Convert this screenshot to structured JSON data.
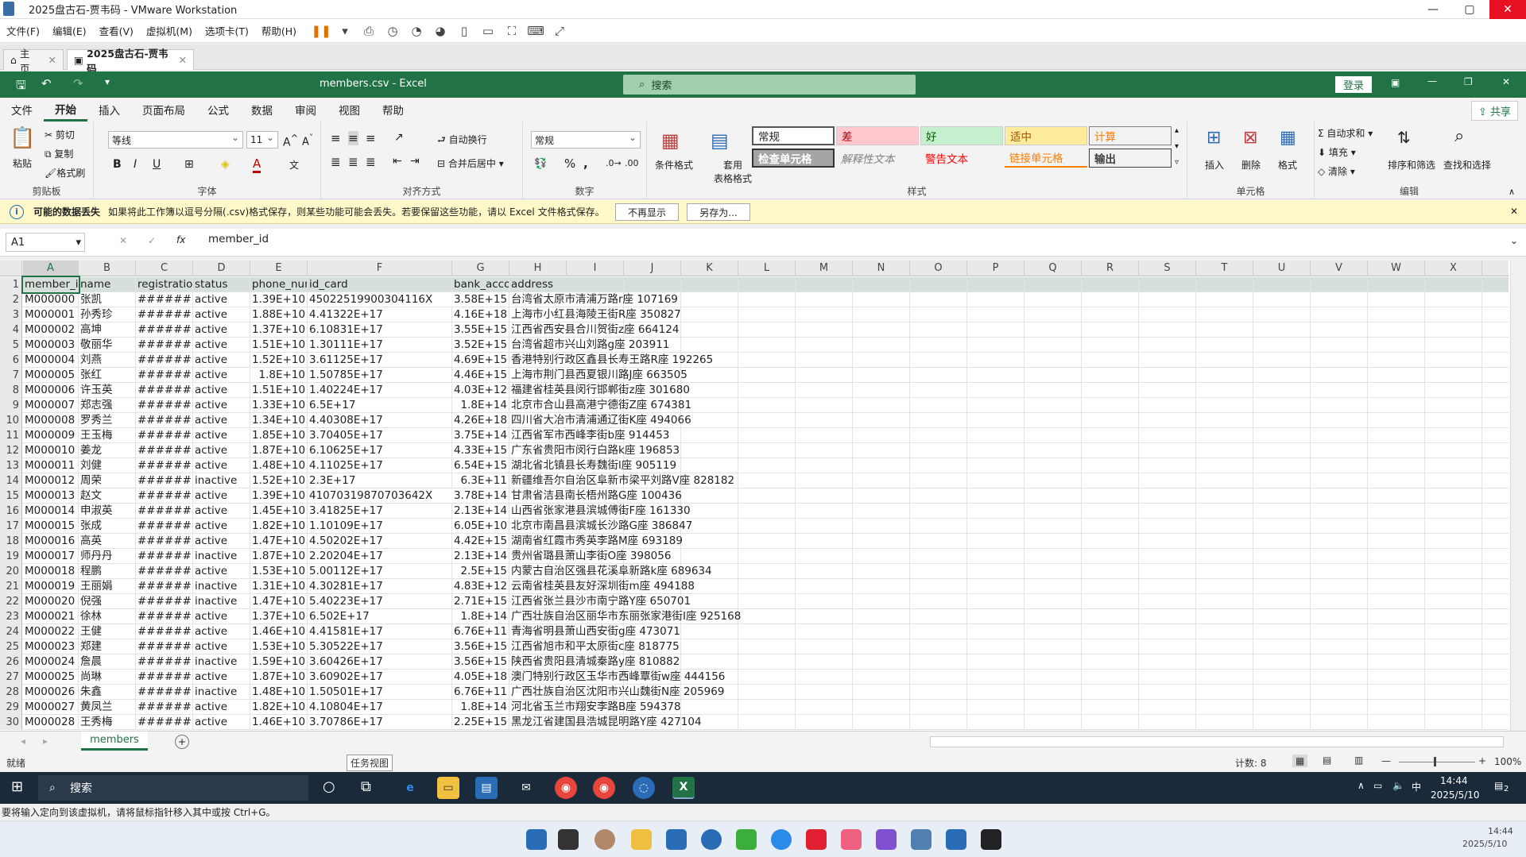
{
  "vmware": {
    "window_title": "2025盘古石-贾韦码 - VMware Workstation",
    "menu": [
      "文件(F)",
      "编辑(E)",
      "查看(V)",
      "虚拟机(M)",
      "选项卡(T)",
      "帮助(H)"
    ],
    "tabs": [
      {
        "label": "主页"
      },
      {
        "label": "2025盘古石-贾韦码"
      }
    ],
    "status_hint": "要将输入定向到该虚拟机，请将鼠标指针移入其中或按 Ctrl+G。"
  },
  "excel": {
    "file_title": "members.csv  -  Excel",
    "search_placeholder": "搜索",
    "login": "登录",
    "share": "共享",
    "ribbon_tabs": [
      "文件",
      "开始",
      "插入",
      "页面布局",
      "公式",
      "数据",
      "审阅",
      "视图",
      "帮助"
    ],
    "clipboard": {
      "paste": "粘贴",
      "cut": "剪切",
      "copy": "复制",
      "format_painter": "格式刷",
      "label": "剪贴板"
    },
    "font": {
      "name": "等线",
      "size": "11",
      "label": "字体"
    },
    "alignment": {
      "wrap": "自动换行",
      "merge": "合并后居中",
      "label": "对齐方式"
    },
    "number": {
      "format": "常规",
      "label": "数字"
    },
    "styles": {
      "conditional": "条件格式",
      "table": "套用\n表格格式",
      "items": [
        "常规",
        "差",
        "好",
        "适中",
        "计算",
        "检查单元格",
        "解释性文本",
        "警告文本",
        "链接单元格",
        "输出"
      ],
      "label": "样式"
    },
    "cells": {
      "insert": "插入",
      "delete": "删除",
      "format": "格式",
      "label": "单元格"
    },
    "editing": {
      "autosum": "自动求和",
      "fill": "填充",
      "clear": "清除",
      "sort": "排序和筛选",
      "find": "查找和选择",
      "label": "编辑"
    },
    "infobar": {
      "title": "可能的数据丢失",
      "message": "如果将此工作簿以逗号分隔(.csv)格式保存，则某些功能可能会丢失。若要保留这些功能，请以 Excel 文件格式保存。",
      "btn_dismiss": "不再显示",
      "btn_saveas": "另存为..."
    },
    "namebox": "A1",
    "formula": "member_id",
    "columns": [
      "A",
      "B",
      "C",
      "D",
      "E",
      "F",
      "G",
      "H",
      "I",
      "J",
      "K",
      "L",
      "M",
      "N",
      "O",
      "P",
      "Q",
      "R",
      "S",
      "T",
      "U",
      "V",
      "W",
      "X"
    ],
    "header_row": [
      "member_id",
      "name",
      "registratio",
      "status",
      "phone_nur",
      "id_card",
      "bank_acco",
      "address"
    ],
    "rows": [
      [
        "M000000",
        "张凯",
        "#######",
        "active",
        "1.39E+10",
        "45022519900304116X",
        "3.58E+15",
        "台湾省太原市清浦万路r座 107169"
      ],
      [
        "M000001",
        "孙秀珍",
        "#######",
        "active",
        "1.88E+10",
        "4.41322E+17",
        "4.16E+18",
        "上海市小红县海陵王街R座 350827"
      ],
      [
        "M000002",
        "高坤",
        "#######",
        "active",
        "1.37E+10",
        "6.10831E+17",
        "3.55E+15",
        "江西省西安县合川贺街z座 664124"
      ],
      [
        "M000003",
        "敬丽华",
        "#######",
        "active",
        "1.51E+10",
        "1.30111E+17",
        "3.52E+15",
        "台湾省超市兴山刘路g座 203911"
      ],
      [
        "M000004",
        "刘燕",
        "#######",
        "active",
        "1.52E+10",
        "3.61125E+17",
        "4.69E+15",
        "香港特别行政区鑫县长寿王路R座 192265"
      ],
      [
        "M000005",
        "张红",
        "#######",
        "active",
        "1.8E+10",
        "1.50785E+17",
        "4.46E+15",
        "上海市荆门县西夏银川路J座 663505"
      ],
      [
        "M000006",
        "许玉英",
        "#######",
        "active",
        "1.51E+10",
        "1.40224E+17",
        "4.03E+12",
        "福建省桂英县闵行邯郸街z座 301680"
      ],
      [
        "M000007",
        "郑志强",
        "#######",
        "active",
        "1.33E+10",
        "6.5E+17",
        "1.8E+14",
        "北京市合山县高港宁德街Z座 674381"
      ],
      [
        "M000008",
        "罗秀兰",
        "#######",
        "active",
        "1.34E+10",
        "4.40308E+17",
        "4.26E+18",
        "四川省大冶市清浦通辽街K座 494066"
      ],
      [
        "M000009",
        "王玉梅",
        "#######",
        "active",
        "1.85E+10",
        "3.70405E+17",
        "3.75E+14",
        "江西省军市西峰李街b座 914453"
      ],
      [
        "M000010",
        "姜龙",
        "#######",
        "active",
        "1.87E+10",
        "6.10625E+17",
        "4.33E+15",
        "广东省贵阳市闵行白路k座 196853"
      ],
      [
        "M000011",
        "刘健",
        "#######",
        "active",
        "1.48E+10",
        "4.11025E+17",
        "6.54E+15",
        "湖北省北镇县长寿魏街l座 905119"
      ],
      [
        "M000012",
        "周荣",
        "#######",
        "inactive",
        "1.52E+10",
        "2.3E+17",
        "6.3E+11",
        "新疆维吾尔自治区阜新市梁平刘路V座 828182"
      ],
      [
        "M000013",
        "赵文",
        "#######",
        "active",
        "1.39E+10",
        "41070319870703642X",
        "3.78E+14",
        "甘肃省洁县南长梧州路G座 100436"
      ],
      [
        "M000014",
        "申淑英",
        "#######",
        "active",
        "1.45E+10",
        "3.41825E+17",
        "2.13E+14",
        "山西省张家港县滨城傅街F座 161330"
      ],
      [
        "M000015",
        "张成",
        "#######",
        "active",
        "1.82E+10",
        "1.10109E+17",
        "6.05E+10",
        "北京市南昌县滨城长沙路G座 386847"
      ],
      [
        "M000016",
        "高英",
        "#######",
        "active",
        "1.47E+10",
        "4.50202E+17",
        "4.42E+15",
        "湖南省红霞市秀英李路M座 693189"
      ],
      [
        "M000017",
        "师丹丹",
        "#######",
        "inactive",
        "1.87E+10",
        "2.20204E+17",
        "2.13E+14",
        "贵州省璐县萧山李街O座 398056"
      ],
      [
        "M000018",
        "程鹏",
        "#######",
        "active",
        "1.53E+10",
        "5.00112E+17",
        "2.5E+15",
        "内蒙古自治区强县花溪阜新路k座 689634"
      ],
      [
        "M000019",
        "王丽娟",
        "#######",
        "inactive",
        "1.31E+10",
        "4.30281E+17",
        "4.83E+12",
        "云南省桂英县友好深圳街m座 494188"
      ],
      [
        "M000020",
        "倪强",
        "#######",
        "inactive",
        "1.47E+10",
        "5.40223E+17",
        "2.71E+15",
        "江西省张兰县沙市南宁路Y座 650701"
      ],
      [
        "M000021",
        "徐林",
        "#######",
        "active",
        "1.37E+10",
        "6.502E+17",
        "1.8E+14",
        "广西壮族自治区丽华市东丽张家港街I座 925168"
      ],
      [
        "M000022",
        "王健",
        "#######",
        "active",
        "1.46E+10",
        "4.41581E+17",
        "6.76E+11",
        "青海省明县萧山西安街g座 473071"
      ],
      [
        "M000023",
        "郑建",
        "#######",
        "active",
        "1.53E+10",
        "5.30522E+17",
        "3.56E+15",
        "江西省旭市和平太原街c座 818775"
      ],
      [
        "M000024",
        "詹晨",
        "#######",
        "inactive",
        "1.59E+10",
        "3.60426E+17",
        "3.56E+15",
        "陕西省贵阳县清城秦路y座 810882"
      ],
      [
        "M000025",
        "尚琳",
        "#######",
        "active",
        "1.87E+10",
        "3.60902E+17",
        "4.05E+18",
        "澳门特别行政区玉华市西峰覃街w座 444156"
      ],
      [
        "M000026",
        "朱鑫",
        "#######",
        "inactive",
        "1.48E+10",
        "1.50501E+17",
        "6.76E+11",
        "广西壮族自治区沈阳市兴山魏街N座 205969"
      ],
      [
        "M000027",
        "黄凤兰",
        "#######",
        "active",
        "1.82E+10",
        "4.10804E+17",
        "1.8E+14",
        "河北省玉兰市翔安李路B座 594378"
      ],
      [
        "M000028",
        "王秀梅",
        "#######",
        "active",
        "1.46E+10",
        "3.70786E+17",
        "2.25E+15",
        "黑龙江省建国县浩城昆明路Y座 427104"
      ]
    ],
    "sheet_tab": "members",
    "status_ready": "就绪",
    "task_view_tooltip": "任务视图",
    "count_label": "计数: 8",
    "zoom": "100%"
  },
  "taskbar": {
    "search_placeholder": "搜索",
    "time": "14:44",
    "date": "2025/5/10",
    "ime": "中",
    "notif_count": "2"
  },
  "host": {
    "time": "14:44",
    "date": "2025/5/10"
  }
}
